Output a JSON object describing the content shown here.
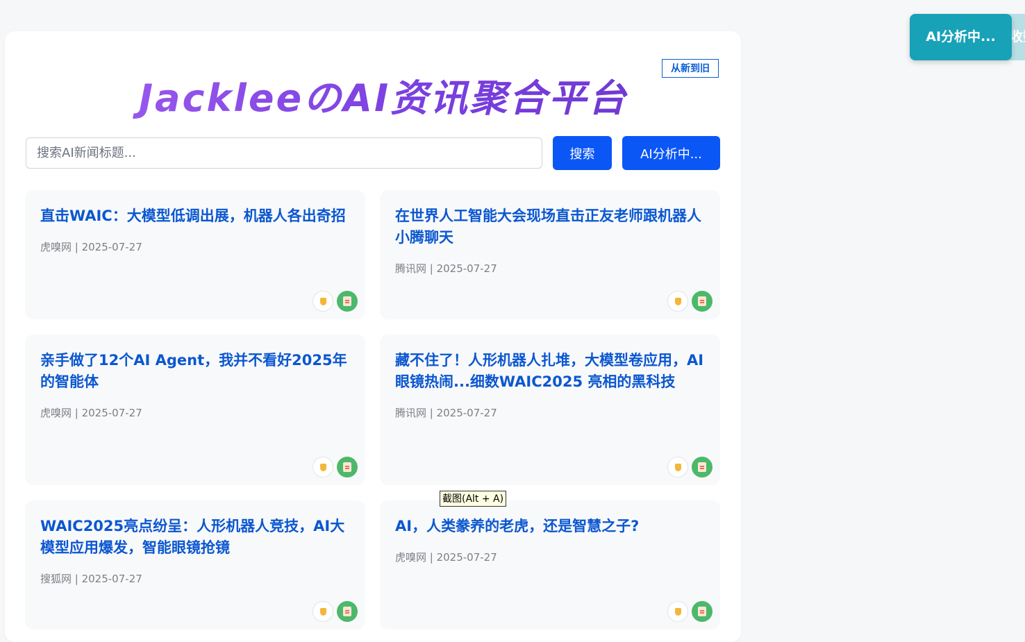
{
  "header": {
    "title": "JackleeのAI资讯聚合平台",
    "sort_label": "从新到旧"
  },
  "search": {
    "placeholder": "搜索AI新闻标题...",
    "value": "",
    "search_label": "搜索",
    "ai_label": "AI分析中..."
  },
  "news": [
    {
      "title": "直击WAIC：大模型低调出展，机器人各出奇招",
      "meta": "虎嗅网 | 2025-07-27"
    },
    {
      "title": "在世界人工智能大会现场直击正友老师跟机器人小腾聊天",
      "meta": "腾讯网 | 2025-07-27"
    },
    {
      "title": "亲手做了12个AI Agent，我并不看好2025年的智能体",
      "meta": "虎嗅网 | 2025-07-27"
    },
    {
      "title": "藏不住了！人形机器人扎堆，大模型卷应用，AI眼镜热闹...细数WAIC2025 亮相的黑科技",
      "meta": "腾讯网 | 2025-07-27"
    },
    {
      "title": "WAIC2025亮点纷呈：人形机器人竞技，AI大模型应用爆发，智能眼镜抢镜",
      "meta": "搜狐网 | 2025-07-27"
    },
    {
      "title": "AI，人类豢养的老虎，还是智慧之子?",
      "meta": "虎嗅网 | 2025-07-27"
    }
  ],
  "tooltip": {
    "text": "截图(Alt + A)"
  },
  "toast": {
    "text": "AI分析中...",
    "ghost_text": "收数"
  },
  "icons": {
    "dislike": "thumbs-down-icon",
    "summary": "document-icon"
  },
  "colors": {
    "accent_blue": "#0b57f5",
    "title_purple": "#8f4de8",
    "toast_teal": "#17a2b8",
    "doc_green": "#4cb86a"
  }
}
